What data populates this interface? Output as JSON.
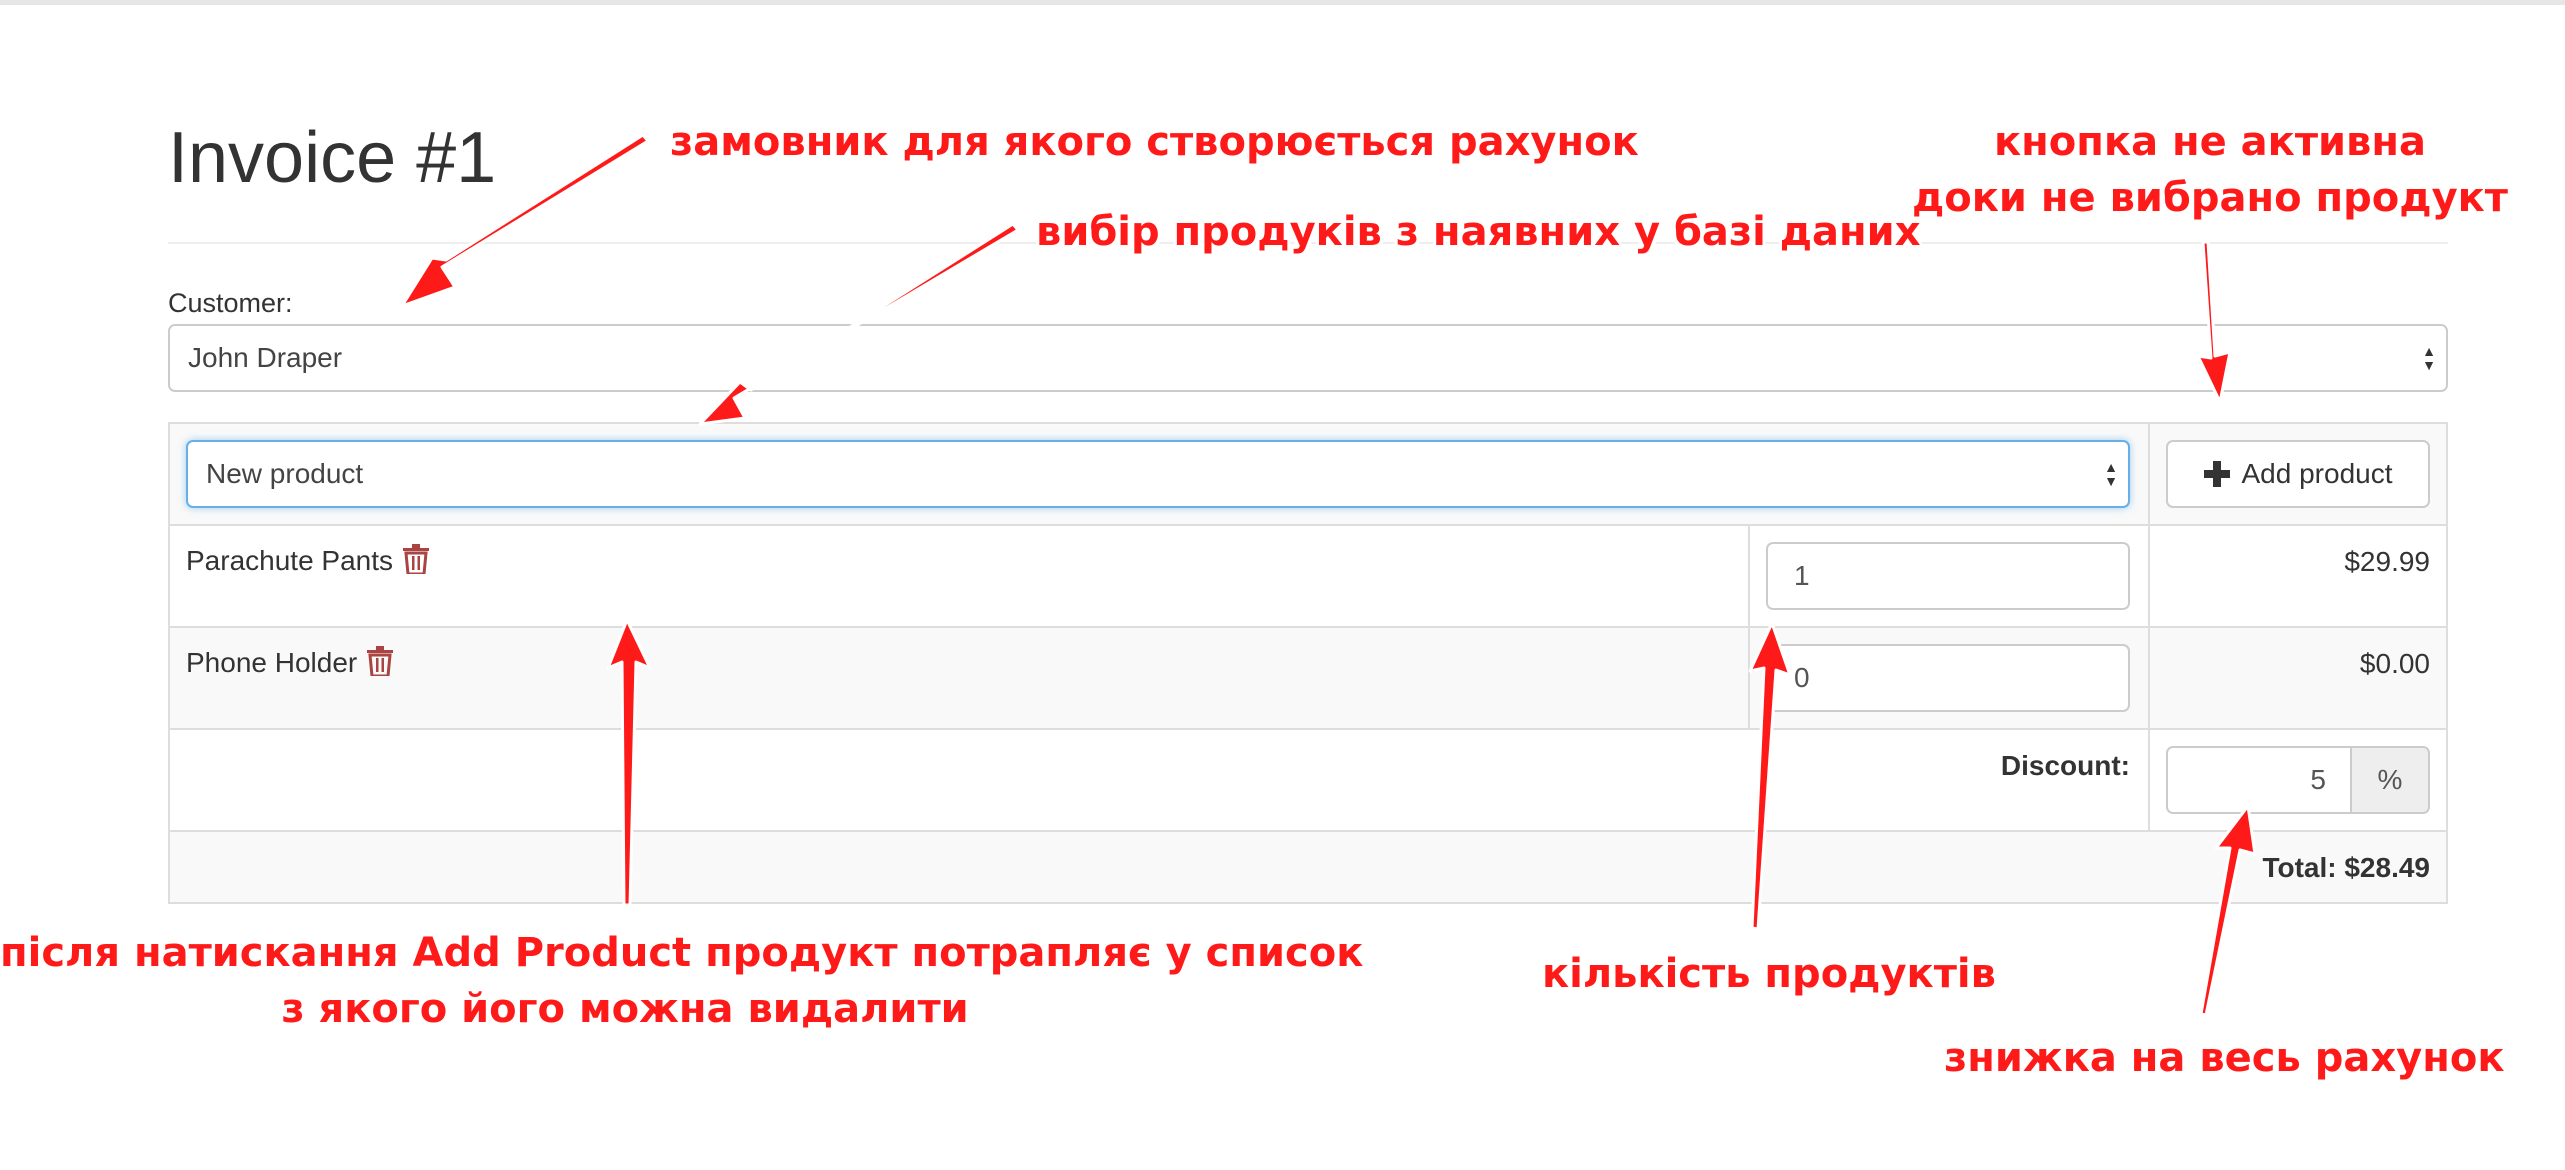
{
  "invoice": {
    "title": "Invoice #1"
  },
  "customer": {
    "label": "Customer:",
    "selected": "John Draper"
  },
  "product_picker": {
    "selected": "New product",
    "add_button_label": "Add product"
  },
  "items": [
    {
      "name": "Parachute Pants",
      "quantity": "1",
      "price": "$29.99"
    },
    {
      "name": "Phone Holder",
      "quantity": "0",
      "price": "$0.00"
    }
  ],
  "discount": {
    "label": "Discount:",
    "value": "5",
    "unit": "%"
  },
  "total": {
    "text": "Total: $28.49"
  },
  "annotations": {
    "customer_note": "замовник для якого створюється рахунок",
    "product_select_note": "вибір продуків з наявних у базі даних",
    "button_note_line1": "кнопка не активна",
    "button_note_line2": "доки не вибрано продукт",
    "list_note_line1": "після натискання Add Product продукт потрапляє у список",
    "list_note_line2": "з якого його можна видалити",
    "quantity_note": "кількість продуктів",
    "discount_note": "знижка на весь рахунок"
  },
  "colors": {
    "annotation": "#ff1a1a",
    "trash_icon": "#a94442",
    "focus_border": "#66afe9"
  },
  "icons": {
    "trash": "trash-icon",
    "plus": "plus-icon",
    "select_caret": "select-caret-icon"
  }
}
